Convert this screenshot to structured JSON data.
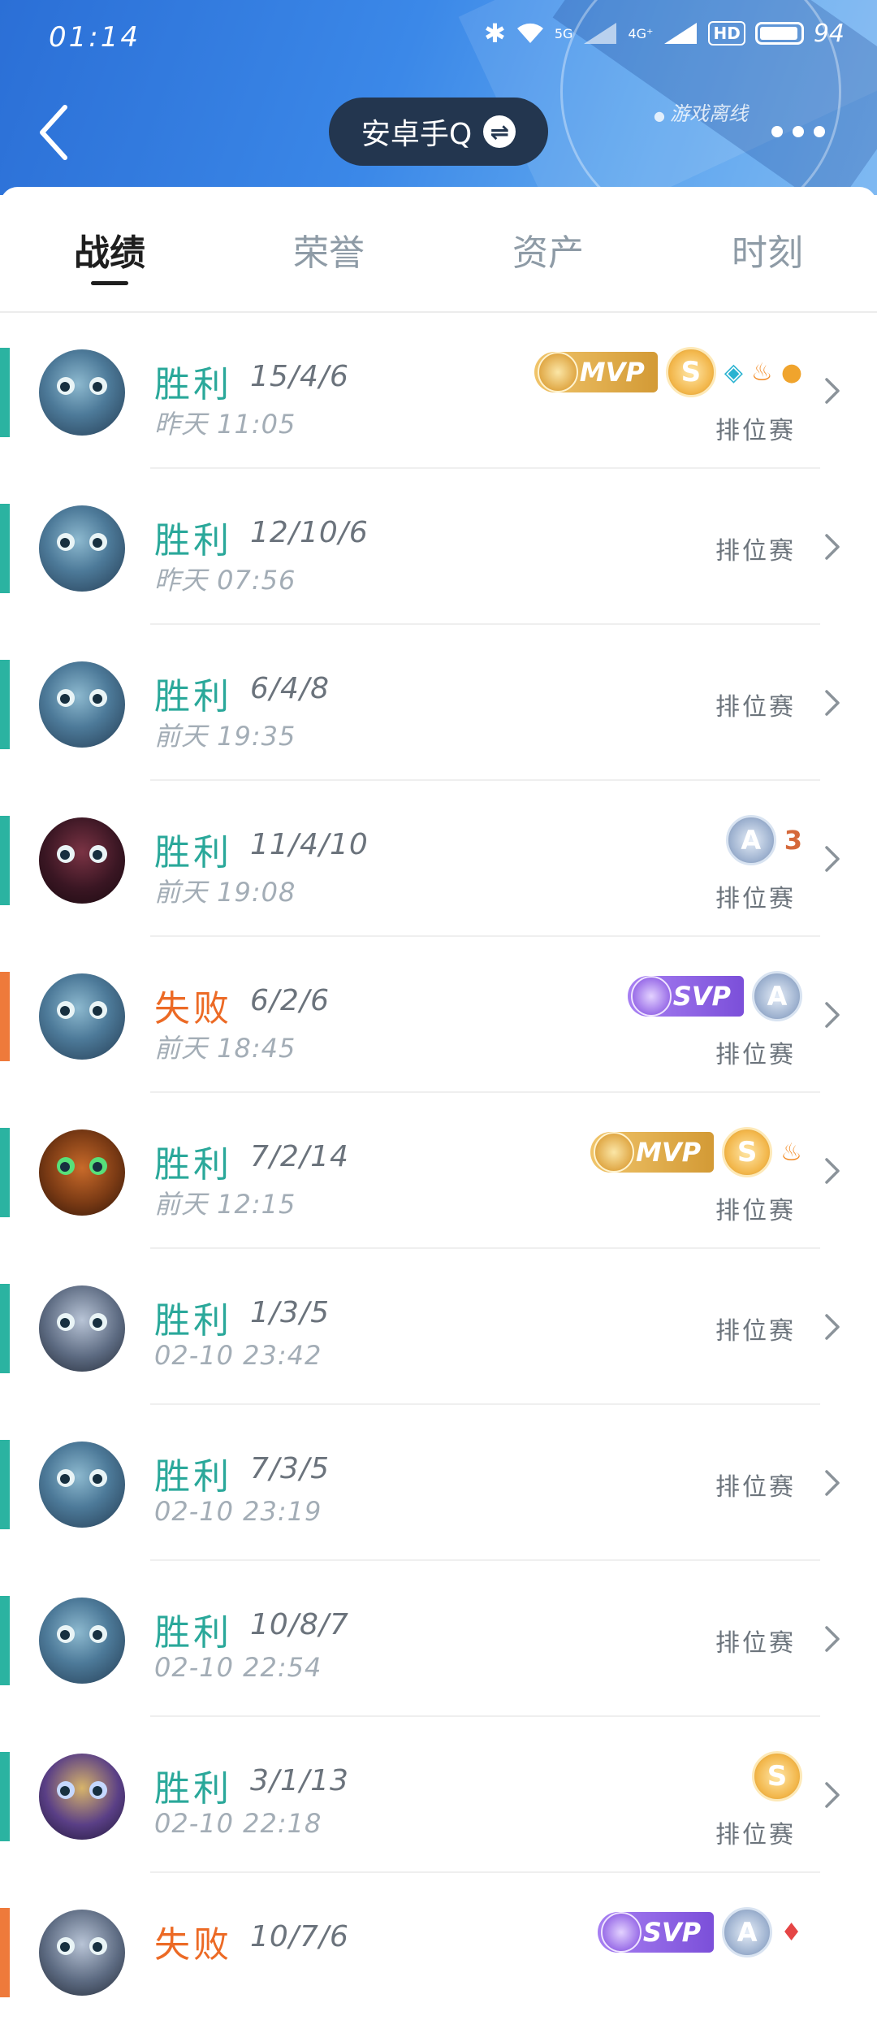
{
  "status_bar": {
    "time": "01:14",
    "network_5g": "5G",
    "network_4g": "4G⁺",
    "hd": "HD",
    "battery": "94"
  },
  "header": {
    "account_name": "安卓手Q",
    "offline_text": "游戏离线"
  },
  "tabs": [
    "战绩",
    "荣誉",
    "资产",
    "时刻"
  ],
  "matches": [
    {
      "result": "胜利",
      "kda": "15/4/6",
      "time": "昨天 11:05",
      "mode": "排位赛",
      "mvp": "MVP",
      "s": "S"
    },
    {
      "result": "胜利",
      "kda": "12/10/6",
      "time": "昨天 07:56",
      "mode": "排位赛"
    },
    {
      "result": "胜利",
      "kda": "6/4/8",
      "time": "前天 19:35",
      "mode": "排位赛"
    },
    {
      "result": "胜利",
      "kda": "11/4/10",
      "time": "前天 19:08",
      "mode": "排位赛",
      "a": "A",
      "three": "3"
    },
    {
      "result": "失败",
      "kda": "6/2/6",
      "time": "前天 18:45",
      "mode": "排位赛",
      "svp": "SVP",
      "a": "A"
    },
    {
      "result": "胜利",
      "kda": "7/2/14",
      "time": "前天 12:15",
      "mode": "排位赛",
      "mvp": "MVP",
      "s": "S"
    },
    {
      "result": "胜利",
      "kda": "1/3/5",
      "time": "02-10 23:42",
      "mode": "排位赛"
    },
    {
      "result": "胜利",
      "kda": "7/3/5",
      "time": "02-10 23:19",
      "mode": "排位赛"
    },
    {
      "result": "胜利",
      "kda": "10/8/7",
      "time": "02-10 22:54",
      "mode": "排位赛"
    },
    {
      "result": "胜利",
      "kda": "3/1/13",
      "time": "02-10 22:18",
      "mode": "排位赛",
      "s": "S"
    },
    {
      "result": "失败",
      "kda": "10/7/6",
      "time": "",
      "mode": "",
      "svp": "SVP",
      "a": "A"
    }
  ],
  "colors": {
    "win": "#2aa89a",
    "lose": "#ec6a25",
    "header_pill": "#23364f"
  }
}
